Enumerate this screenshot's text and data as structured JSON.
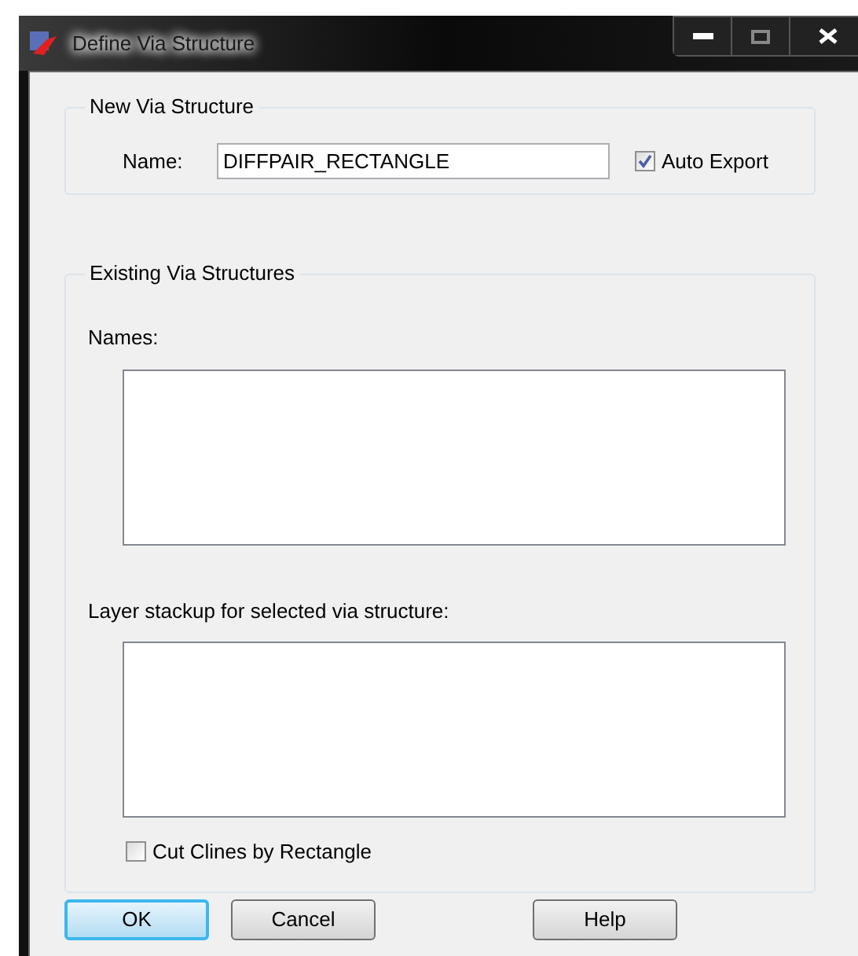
{
  "window": {
    "title": "Define Via Structure"
  },
  "new_group": {
    "title": "New Via Structure",
    "name_label": "Name:",
    "name_value": "DIFFPAIR_RECTANGLE",
    "auto_export": {
      "label": "Auto Export",
      "checked": true
    }
  },
  "existing_group": {
    "title": "Existing Via Structures",
    "names_label": "Names:",
    "stackup_label": "Layer stackup for selected via structure:",
    "cut_clines": {
      "label": "Cut Clines by Rectangle",
      "checked": false
    }
  },
  "buttons": [
    {
      "label": "OK",
      "default": true
    },
    {
      "label": "Cancel",
      "default": false
    },
    {
      "label": "Help",
      "default": false
    }
  ]
}
